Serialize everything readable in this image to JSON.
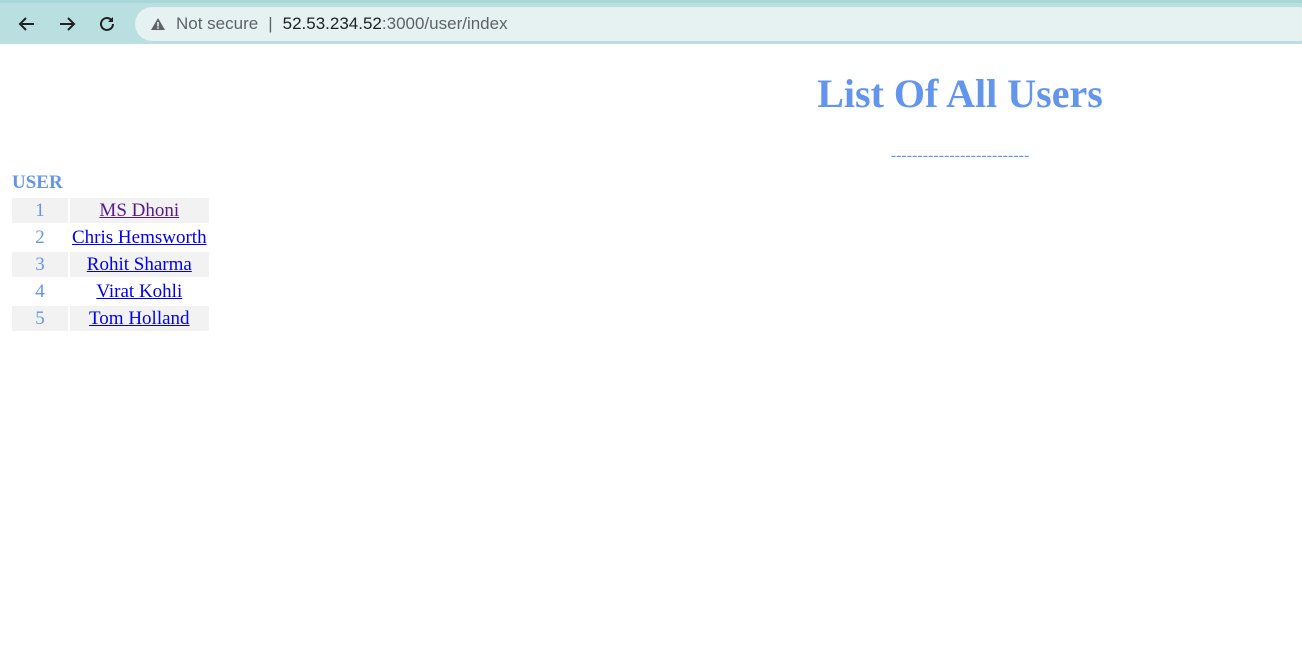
{
  "browser": {
    "security_label": "Not secure",
    "separator": "|",
    "url_host": "52.53.234.52",
    "url_path": ":3000/user/index"
  },
  "page": {
    "title": "List Of All Users",
    "rule": "--------------------------",
    "table_caption": "USER",
    "users": [
      {
        "index": "1",
        "name": "MS Dhoni"
      },
      {
        "index": "2",
        "name": "Chris Hemsworth"
      },
      {
        "index": "3",
        "name": "Rohit Sharma"
      },
      {
        "index": "4",
        "name": "Virat Kohli"
      },
      {
        "index": "5",
        "name": "Tom Holland"
      }
    ]
  },
  "colors": {
    "accent": "#6495ed",
    "link": "#0000ee",
    "visited_link": "#551a8b",
    "row_shade": "#f2f2f2",
    "toolbar": "#b9dfe1"
  }
}
